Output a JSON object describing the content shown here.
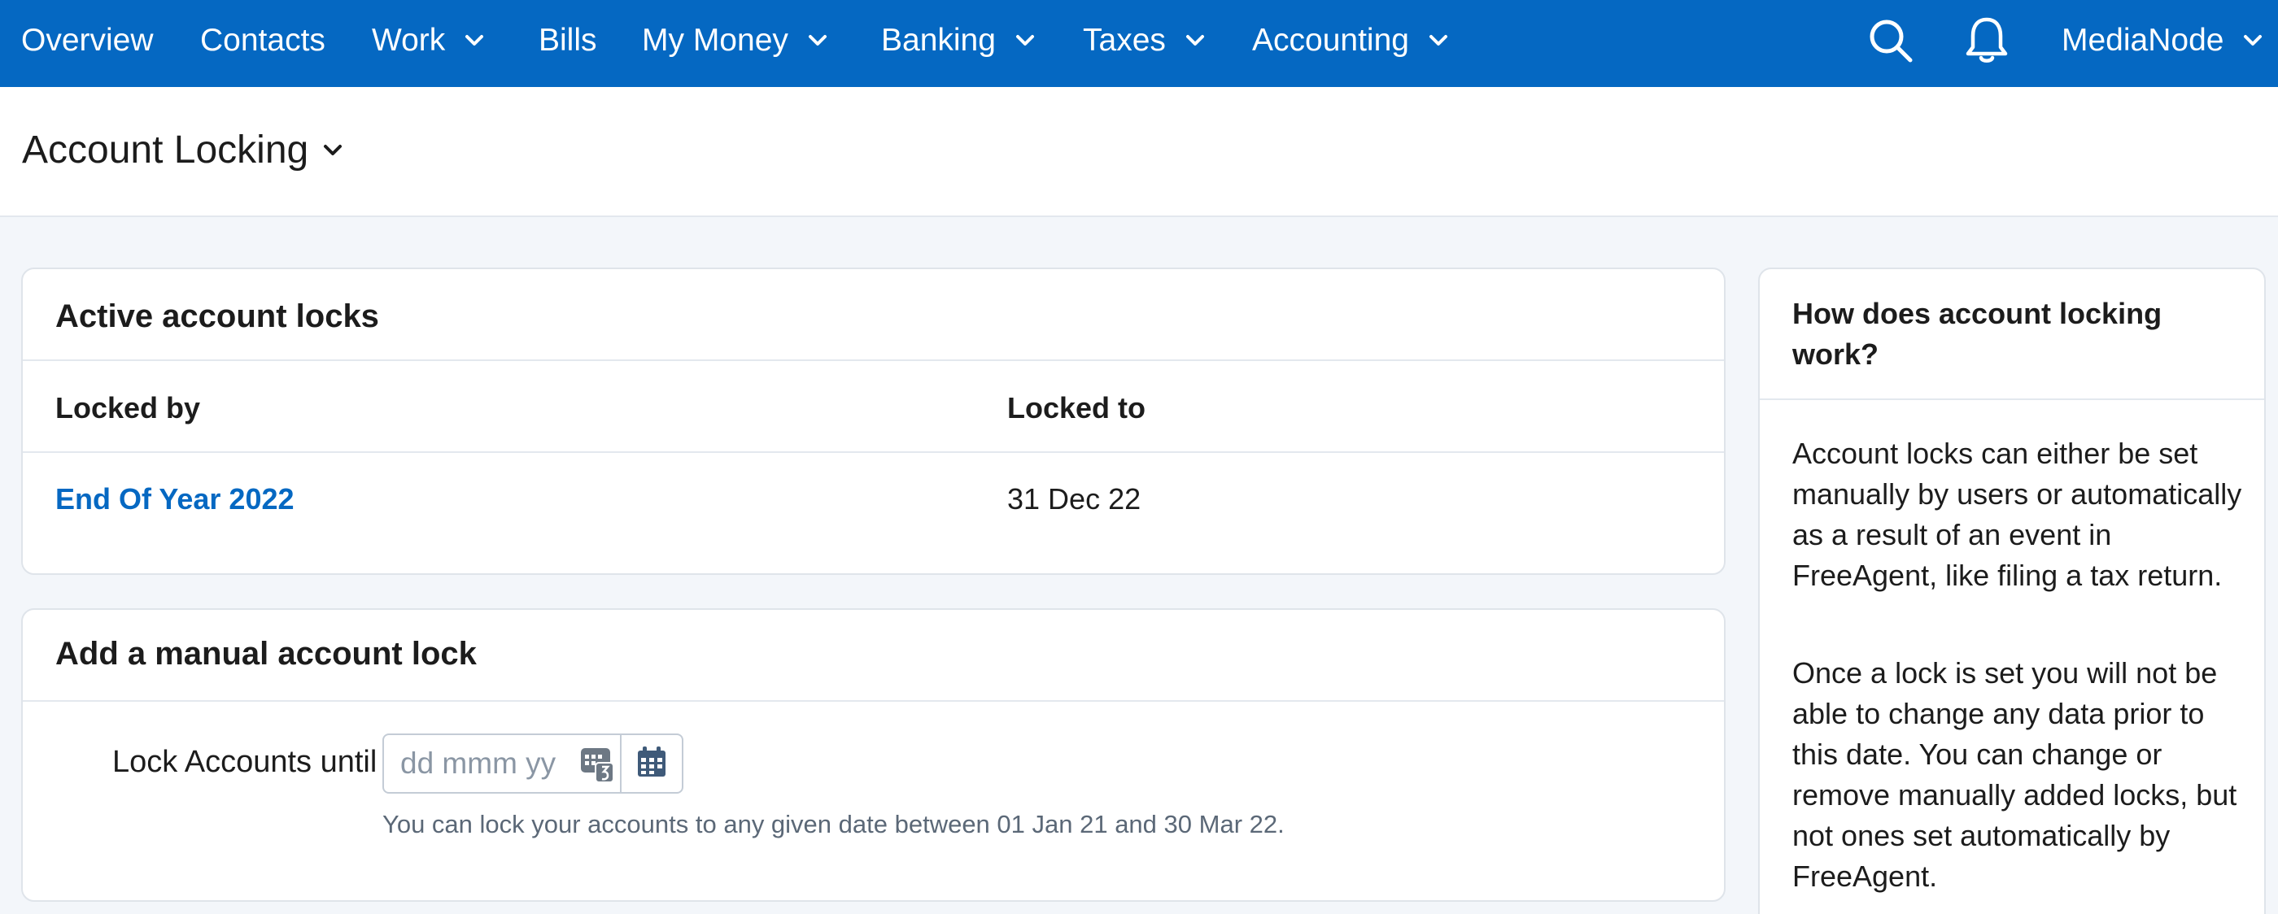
{
  "nav": {
    "items": [
      {
        "label": "Overview"
      },
      {
        "label": "Contacts"
      },
      {
        "label": "Work",
        "dropdown": true
      },
      {
        "label": "Bills"
      },
      {
        "label": "My Money",
        "dropdown": true
      },
      {
        "label": "Banking",
        "dropdown": true
      },
      {
        "label": "Taxes",
        "dropdown": true
      },
      {
        "label": "Accounting",
        "dropdown": true
      }
    ],
    "search_icon": "search-icon",
    "notifications_icon": "bell-icon",
    "account_label": "MediaNode"
  },
  "page": {
    "title": "Account Locking"
  },
  "active_locks": {
    "title": "Active account locks",
    "columns": [
      "Locked by",
      "Locked to"
    ],
    "rows": [
      {
        "locked_by": "End Of Year 2022",
        "locked_to": "31 Dec 22"
      }
    ]
  },
  "manual_lock": {
    "title": "Add a manual account lock",
    "field_label": "Lock Accounts until",
    "date_placeholder": "dd mmm yy",
    "date_value": "",
    "calendar_icon": "calendar-icon",
    "hint": "You can lock your accounts to any given date between 01 Jan 21 and 30 Mar 22."
  },
  "help": {
    "title": "How does account locking work?",
    "paragraphs": [
      "Account locks can either be set manually by users or automatically as a result of an event in FreeAgent, like filing a tax return.",
      "Once a lock is set you will not be able to change any data prior to this date. You can change or remove manually added locks, but not ones set automatically by FreeAgent."
    ]
  },
  "colors": {
    "brand_blue": "#0568c2",
    "page_bg": "#f3f6fa",
    "link": "#0568c2"
  }
}
